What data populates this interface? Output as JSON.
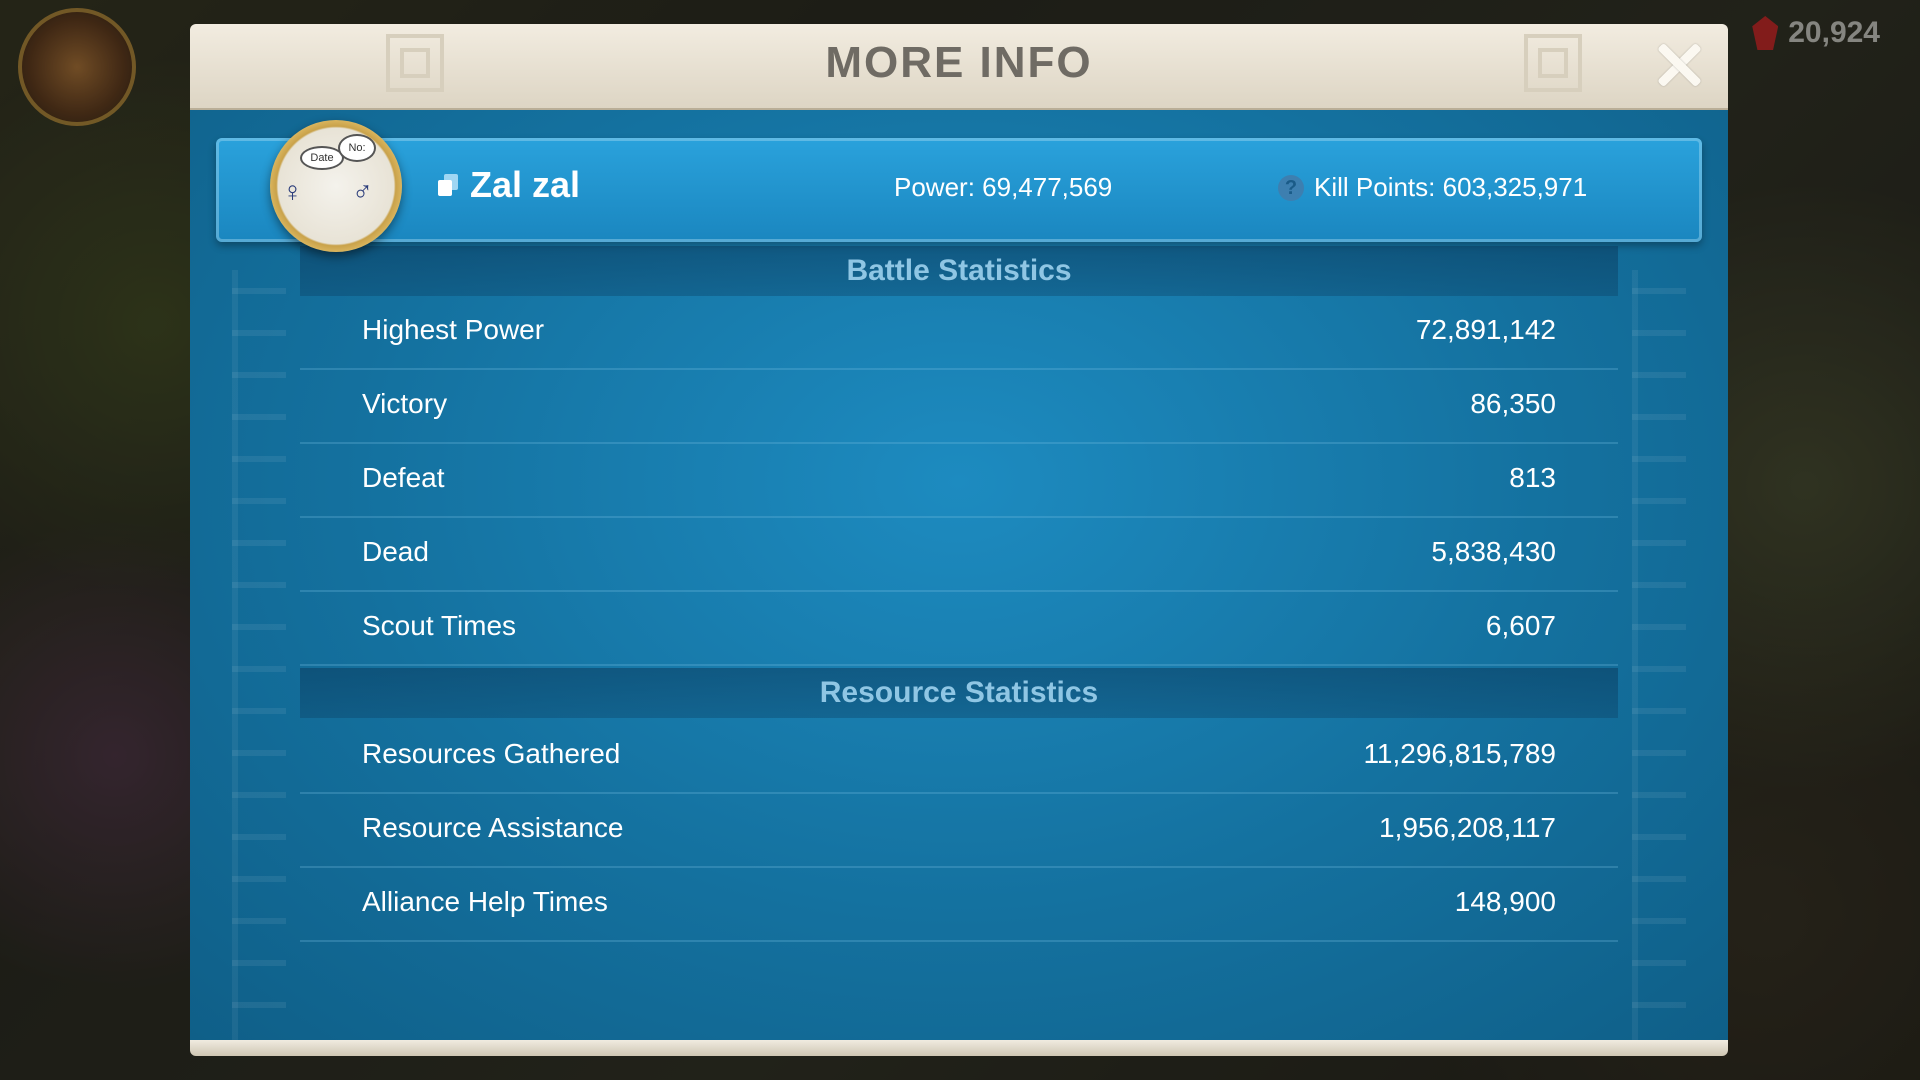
{
  "hud": {
    "gems": "20,924"
  },
  "dialog": {
    "title": "MORE INFO"
  },
  "player": {
    "name": "Zal zal",
    "power": "Power: 69,477,569",
    "kill_points": "Kill Points: 603,325,971",
    "avatar_doodle": {
      "date": "Date",
      "no": "No:"
    }
  },
  "battle": {
    "title": "Battle Statistics",
    "rows": [
      {
        "label": "Highest Power",
        "value": "72,891,142"
      },
      {
        "label": "Victory",
        "value": "86,350"
      },
      {
        "label": "Defeat",
        "value": "813"
      },
      {
        "label": "Dead",
        "value": "5,838,430"
      },
      {
        "label": "Scout Times",
        "value": "6,607"
      }
    ]
  },
  "resource": {
    "title": "Resource Statistics",
    "rows": [
      {
        "label": "Resources Gathered",
        "value": "11,296,815,789"
      },
      {
        "label": "Resource Assistance",
        "value": "1,956,208,117"
      },
      {
        "label": "Alliance Help Times",
        "value": "148,900"
      }
    ]
  },
  "colors": {
    "panel_blue": "#1a86bf",
    "header_beige": "#e8e1d2",
    "section_title_text": "#8fc6e4"
  }
}
